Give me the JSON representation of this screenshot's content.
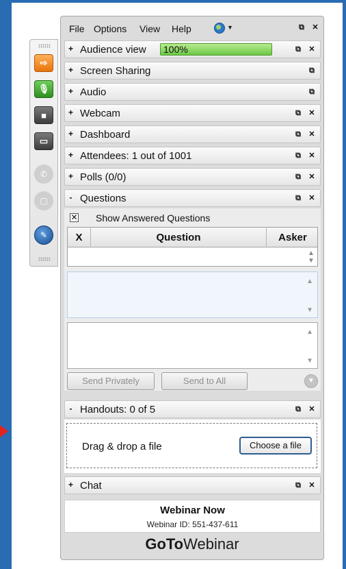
{
  "menu": {
    "items": [
      "File",
      "Options",
      "View",
      "Help"
    ],
    "globe_icon": "globe-icon"
  },
  "sections": [
    {
      "label": "Audience view",
      "state": "+"
    },
    {
      "label": "Screen Sharing",
      "state": "+"
    },
    {
      "label": "Audio",
      "state": "+"
    },
    {
      "label": "Webcam",
      "state": "+"
    },
    {
      "label": "Dashboard",
      "state": "+"
    },
    {
      "label": "Attendees: 1 out of 1001",
      "state": "+"
    },
    {
      "label": "Polls (0/0)",
      "state": "+"
    },
    {
      "label": "Questions",
      "state": "-"
    },
    {
      "label": "Handouts: 0 of 5",
      "state": "-"
    },
    {
      "label": "Chat",
      "state": "+"
    }
  ],
  "audience_view": {
    "progress_text": "100%",
    "progress_value": 1.0
  },
  "questions": {
    "show_answered_label": "Show Answered Questions",
    "show_answered_checked": true,
    "columns": {
      "x": "X",
      "question": "Question",
      "asker": "Asker"
    },
    "send_privately": "Send Privately",
    "send_to_all": "Send to All"
  },
  "handouts": {
    "drop_label": "Drag & drop a file",
    "choose_button": "Choose a file"
  },
  "webinar": {
    "title": "Webinar Now",
    "id_text": "Webinar ID: 551-437-611"
  },
  "brand": {
    "part1": "GoTo",
    "part2": "Webinar"
  },
  "icons": {
    "undock": "undock-icon",
    "close": "close-icon",
    "popout": "popout-icon",
    "arrow": "arrow-right-icon",
    "mic": "microphone-icon",
    "webcam": "webcam-icon",
    "screen": "screen-icon",
    "phone": "phone-icon",
    "chat": "chat-icon",
    "draw": "drawing-tools-icon"
  },
  "colors": {
    "background": "#2a6cb3",
    "progress_green": "#6cc947",
    "mic_green": "#3a9b2a",
    "arrow_orange": "#f08a18"
  }
}
